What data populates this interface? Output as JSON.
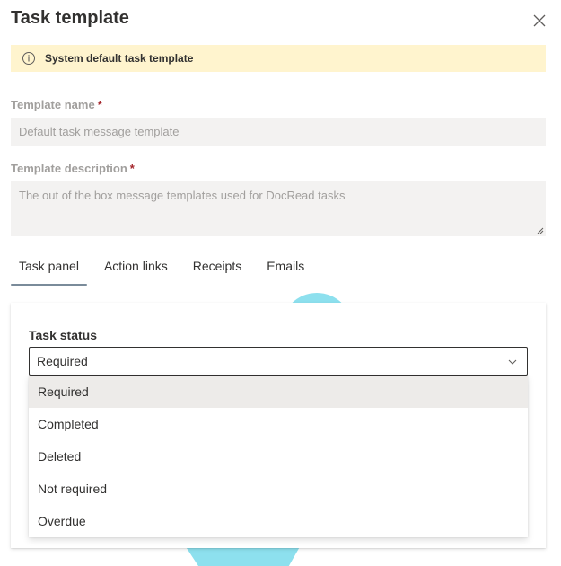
{
  "panel": {
    "title": "Task template",
    "close_icon": "close-icon"
  },
  "banner": {
    "icon": "info-icon",
    "text": "System default task template",
    "background": "#fff4ce"
  },
  "template_name": {
    "label": "Template name",
    "required_marker": "*",
    "value": "Default task message template"
  },
  "template_description": {
    "label": "Template description",
    "required_marker": "*",
    "value": "The out of the box message templates used for DocRead tasks"
  },
  "tabs": [
    {
      "label": "Task panel",
      "active": true
    },
    {
      "label": "Action links",
      "active": false
    },
    {
      "label": "Receipts",
      "active": false
    },
    {
      "label": "Emails",
      "active": false
    }
  ],
  "task_status": {
    "label": "Task status",
    "selected": "Required",
    "chevron_icon": "chevron-down-icon",
    "options": [
      "Required",
      "Completed",
      "Deleted",
      "Not required",
      "Overdue"
    ]
  },
  "colors": {
    "required_star": "#a4262c",
    "decoration": "#8de0ee",
    "selected_option": "#edebe9"
  }
}
